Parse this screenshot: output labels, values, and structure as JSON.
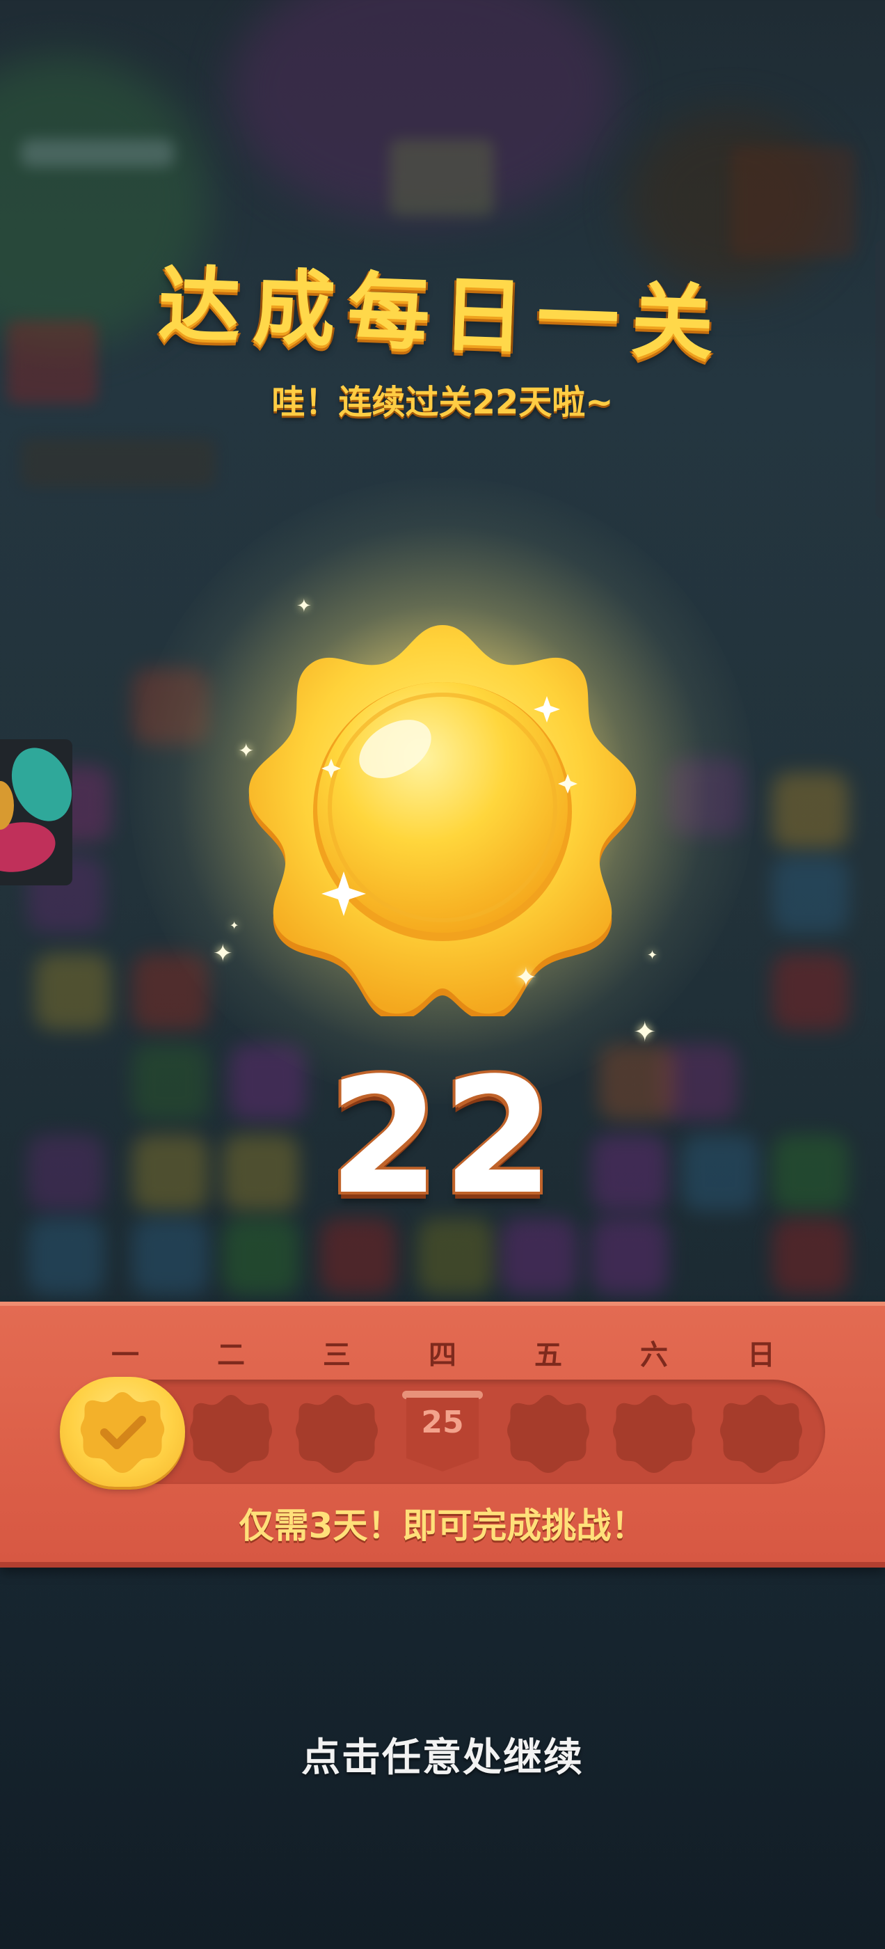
{
  "header": {
    "title": "达成每日一关",
    "subtitle": "哇！连续过关22天啦~"
  },
  "badge": {
    "icon": "sun-badge-icon",
    "streak_count": "22"
  },
  "week": {
    "days": [
      {
        "label": "一",
        "state": "completed"
      },
      {
        "label": "二",
        "state": "locked"
      },
      {
        "label": "三",
        "state": "locked"
      },
      {
        "label": "四",
        "state": "today",
        "date": "25"
      },
      {
        "label": "五",
        "state": "locked"
      },
      {
        "label": "六",
        "state": "locked"
      },
      {
        "label": "日",
        "state": "locked"
      }
    ],
    "challenge_message": "仅需3天！即可完成挑战！"
  },
  "footer": {
    "continue_hint": "点击任意处继续"
  },
  "colors": {
    "title_yellow": "#ffd84a",
    "panel_red": "#dc5f48",
    "slot_dark": "#a63c2b",
    "done_gold": "#ffd145"
  }
}
